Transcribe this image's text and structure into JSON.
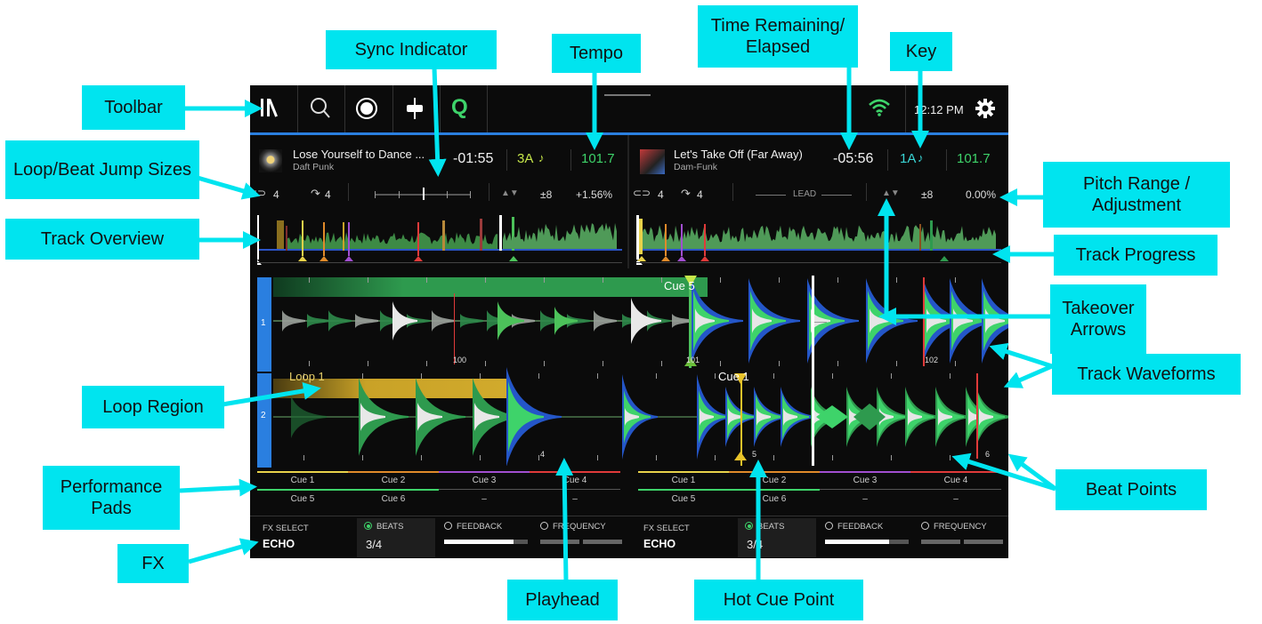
{
  "toolbar": {
    "icons": [
      "library-icon",
      "search-icon",
      "record-icon",
      "split-icon",
      "quantize-icon",
      "wifi-icon",
      "gear-icon"
    ],
    "quantize_glyph": "Q",
    "time": "12:12 PM"
  },
  "deck1": {
    "title": "Lose Yourself to Dance ...",
    "artist": "Daft Punk",
    "time_remaining": "-01:55",
    "key": "3A",
    "tempo": "101.7",
    "loop_size": "4",
    "jump_size": "4",
    "pitch_range": "±8",
    "pitch_adjust": "+1.56%",
    "waveform_label": "1",
    "beat_markers": [
      "100",
      "101",
      "102"
    ],
    "cue_label": "Cue 5",
    "fx_select_label": "FX SELECT",
    "fx_name": "ECHO",
    "fx_params": [
      "BEATS",
      "FEEDBACK",
      "FREQUENCY"
    ],
    "fx_beats_value": "3/4"
  },
  "deck2": {
    "title": "Let's Take Off (Far Away)",
    "artist": "Dam-Funk",
    "time_remaining": "-05:56",
    "key": "1A",
    "tempo": "101.7",
    "loop_size": "4",
    "jump_size": "4",
    "lead_label": "LEAD",
    "pitch_range": "±8",
    "pitch_adjust": "0.00%",
    "waveform_label": "2",
    "loop_label": "Loop 1",
    "cue_label": "Cue 1",
    "beat_markers": [
      "4",
      "5",
      "6"
    ],
    "fx_select_label": "FX SELECT",
    "fx_name": "ECHO",
    "fx_params": [
      "BEATS",
      "FEEDBACK",
      "FREQUENCY"
    ],
    "fx_beats_value": "3/4"
  },
  "pads_left": [
    "Cue 1",
    "Cue 2",
    "Cue 3",
    "Cue 4",
    "Cue 5",
    "Cue 6",
    "–",
    "–"
  ],
  "pads_right": [
    "Cue 1",
    "Cue 2",
    "Cue 3",
    "Cue 4",
    "Cue 5",
    "Cue 6",
    "–",
    "–"
  ],
  "callouts": {
    "toolbar": "Toolbar",
    "sync_indicator": "Sync Indicator",
    "tempo": "Tempo",
    "time_remaining": "Time Remaining/ Elapsed",
    "key": "Key",
    "loop_beat_jump": "Loop/Beat Jump Sizes",
    "pitch_range": "Pitch Range / Adjustment",
    "track_overview": "Track Overview",
    "track_progress": "Track Progress",
    "takeover_arrows": "Takeover Arrows",
    "track_waveforms": "Track Waveforms",
    "loop_region": "Loop Region",
    "beat_points": "Beat Points",
    "performance_pads": "Performance Pads",
    "fx": "FX",
    "playhead": "Playhead",
    "hot_cue_point": "Hot Cue Point"
  },
  "colors": {
    "accent_blue": "#2a7fe0",
    "key_green": "#c6e64a",
    "key_cyan": "#3ad6d6",
    "tempo_green": "#3ed36a",
    "callout": "#00e4ef",
    "loop_gold": "#c9a227",
    "cue_green": "#2e9a4e"
  }
}
